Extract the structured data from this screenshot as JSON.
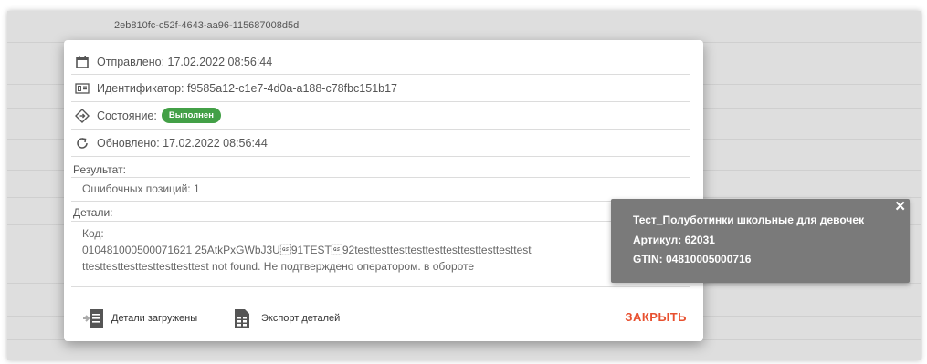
{
  "background": {
    "row_id": "2eb810fc-c52f-4643-aa96-115687008d5d"
  },
  "dialog": {
    "sent": "Отправлено: 17.02.2022 08:56:44",
    "identifier": "Идентификатор: f9585a12-c1e7-4d0a-a188-c78fbc151b17",
    "state_label": "Состояние:",
    "state_badge": "Выполнен",
    "updated": "Обновлено: 17.02.2022 08:56:44",
    "result_label": "Результат:",
    "result_text": "Ошибочных позиций: 1",
    "details_label": "Детали:",
    "details_line1": "Код:",
    "details_line2": "010481000500071621 25AtkPxGWbJ3U\u001d91TEST\u001d92testtesttesttesttesttesttesttesttesttest",
    "details_line3": "ttesttesttesttesttesttesttest not found. Не подтверждено оператором. в обороте",
    "footer": {
      "details_loaded": "Детали загружены",
      "export_details": "Экспорт деталей",
      "close": "ЗАКРЫТЬ"
    },
    "icons": {
      "sent": "calendar-icon",
      "identifier": "id-card-icon",
      "state": "diamond-tag-icon",
      "updated": "refresh-icon",
      "details_loaded": "import-icon",
      "export": "document-icon"
    }
  },
  "tooltip": {
    "title": "Тест_Полуботинки школьные для девочек",
    "article": "Артикул: 62031",
    "gtin": "GTIN: 04810005000716",
    "close": "✕"
  },
  "colors": {
    "badge_green": "#43a047",
    "close_red": "#e8502f",
    "tooltip_bg": "#7a7a7a"
  }
}
